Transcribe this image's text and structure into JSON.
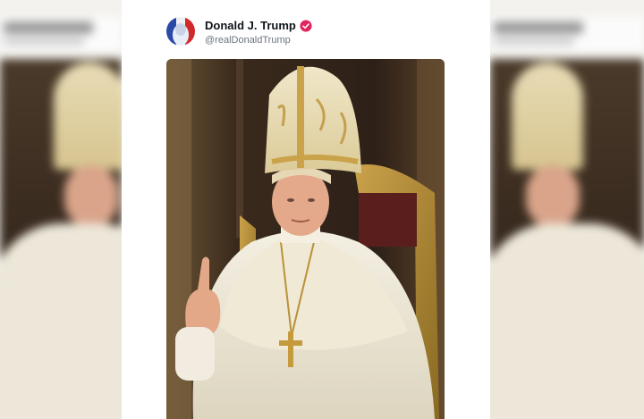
{
  "post": {
    "author": {
      "display_name": "Donald J. Trump",
      "handle": "@realDonaldTrump",
      "verified": true,
      "avatar_icon": "profile-avatar"
    },
    "media": {
      "type": "image",
      "description_icon": "pope-portrait-image"
    }
  },
  "colors": {
    "verified_badge": "#e0245e",
    "name_text": "#0f1419",
    "handle_text": "#6b7280"
  }
}
